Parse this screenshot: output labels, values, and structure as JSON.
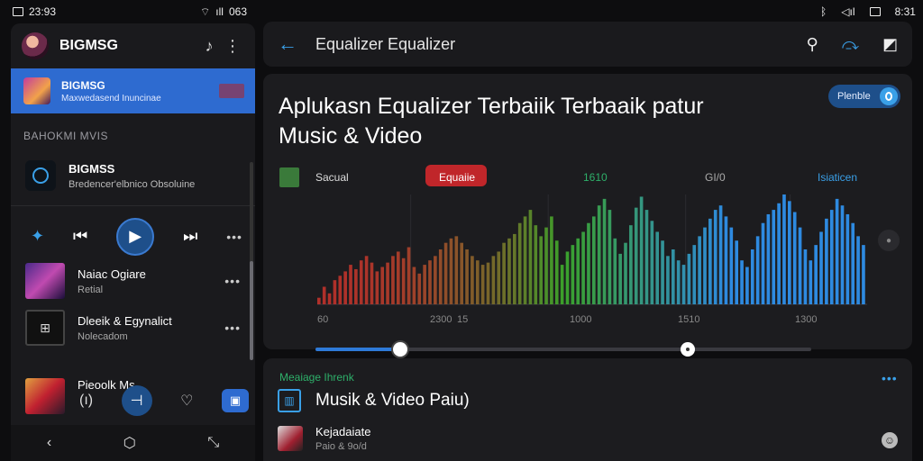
{
  "status_bar": {
    "left_time": "23:93",
    "left_signal": "063",
    "right_time": "8:31"
  },
  "left_pane": {
    "header_title": "BIGMSG",
    "highlight": {
      "title": "BIGMSG",
      "subtitle": "Maxwedasend Inuncinae"
    },
    "section_label": "BAHOKMI MVIS",
    "now_playing": {
      "title": "BIGMSS",
      "subtitle": "Bredencer'elbnico Obsoluine"
    },
    "list": [
      {
        "title": "Naiac Ogiare",
        "subtitle": "Retial"
      },
      {
        "title": "Dleeik & Egynalict",
        "subtitle": "Nolecadom"
      },
      {
        "title": "Pieoolk Ms",
        "subtitle": ""
      }
    ],
    "cover2_glyph": "⊞"
  },
  "top_bar": {
    "title": "Equalizer  Equalizer"
  },
  "main_card": {
    "headline": "Aplukasn Equalizer Terbaiik Terbaaik patur Music & Video",
    "toggle_label": "Plenble"
  },
  "chart_data": {
    "type": "bar",
    "legend": {
      "item1": "Sacual",
      "item2": "Equaiie",
      "item3": "1610",
      "item4": "GI/0",
      "item5": "Isiaticen"
    },
    "x_tick_labels": [
      "60",
      "2300",
      "15",
      "1000",
      "1510",
      "1300"
    ],
    "values": [
      6,
      16,
      10,
      22,
      26,
      30,
      36,
      32,
      40,
      44,
      38,
      30,
      34,
      38,
      44,
      48,
      42,
      52,
      34,
      28,
      36,
      40,
      44,
      50,
      56,
      60,
      62,
      56,
      50,
      44,
      40,
      36,
      38,
      44,
      48,
      56,
      60,
      64,
      74,
      80,
      86,
      72,
      62,
      70,
      80,
      58,
      36,
      48,
      54,
      60,
      66,
      74,
      80,
      90,
      96,
      86,
      60,
      46,
      56,
      72,
      88,
      98,
      86,
      76,
      66,
      58,
      44,
      50,
      40,
      36,
      46,
      54,
      62,
      70,
      78,
      86,
      90,
      80,
      70,
      58,
      40,
      34,
      50,
      62,
      74,
      82,
      86,
      92,
      100,
      94,
      84,
      70,
      50,
      40,
      54,
      66,
      78,
      86,
      96,
      90,
      82,
      74,
      62,
      54
    ],
    "ylim": [
      0,
      100
    ],
    "colors": [
      "#b0302a",
      "#3aa02a",
      "#2e8ae0"
    ]
  },
  "slider": {
    "value": 0.17,
    "value2": 0.75
  },
  "bottom_card": {
    "tag": "Meaiage Ihrenk",
    "title": "Musik & Video Paiu)",
    "item_title": "Kejadaiate",
    "item_subtitle": "Paio & 9o/d"
  }
}
